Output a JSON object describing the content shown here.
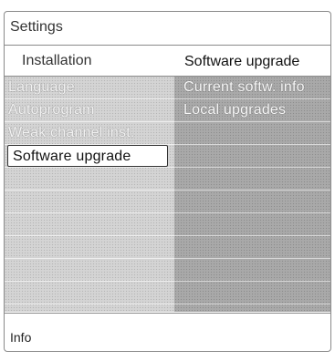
{
  "header": {
    "title": "Settings"
  },
  "subheader": {
    "section": "Installation",
    "current": "Software upgrade"
  },
  "menu": {
    "items": [
      {
        "label": "Language"
      },
      {
        "label": "Autoprogram"
      },
      {
        "label": "Weak channel inst."
      },
      {
        "label": "Software upgrade",
        "selected": true
      }
    ]
  },
  "submenu": {
    "items": [
      {
        "label": "Current softw. info"
      },
      {
        "label": "Local upgrades"
      }
    ]
  },
  "footer": {
    "info": "Info"
  }
}
